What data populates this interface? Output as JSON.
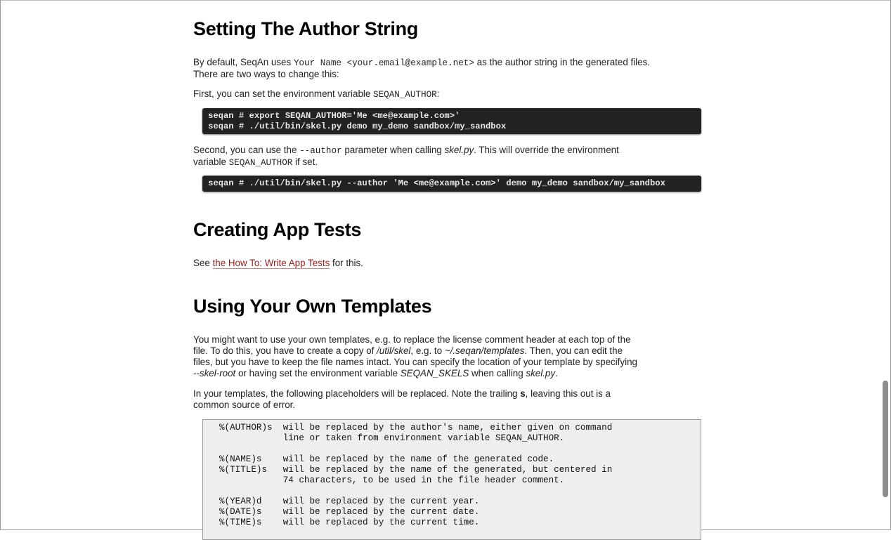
{
  "sections": {
    "author": {
      "heading": "Setting The Author String",
      "p1": {
        "a": "By default, SeqAn uses ",
        "code": "Your Name <your.email@example.net>",
        "b": " as the author string in the generated files.",
        "line2": "There are two ways to change this:"
      },
      "p2": {
        "a": "First, you can set the environment variable ",
        "code": "SEQAN_AUTHOR",
        "b": ":"
      },
      "shell1": {
        "line1": "seqan # export SEQAN_AUTHOR='Me <me@example.com>'",
        "line2": "seqan # ./util/bin/skel.py demo my_demo sandbox/my_sandbox"
      },
      "p3": {
        "a": "Second, you can use the ",
        "code": "--author",
        "b": " parameter when calling ",
        "em": "skel.py",
        "c": ". This will override the environment",
        "line2a": "variable ",
        "code2": "SEQAN_AUTHOR",
        "line2b": " if set."
      },
      "shell2": {
        "line1": "seqan # ./util/bin/skel.py --author 'Me <me@example.com>' demo my_demo sandbox/my_sandbox"
      }
    },
    "tests": {
      "heading": "Creating App Tests",
      "a": "See ",
      "link": "the How To: Write App Tests",
      "b": " for this."
    },
    "templates": {
      "heading": "Using Your Own Templates",
      "l1": "You might want to use your own templates, e.g. to replace the license comment header at each top of the",
      "l2a": "file. To do this, you have to create a copy of ",
      "l2em1": "/util/skel",
      "l2b": ", e.g. to ",
      "l2em2": "~/.seqan/templates",
      "l2c": ". Then, you can edit the",
      "l3": "files, but you have to keep the file names intact. You can specify the location of your template by specifying",
      "l4em1": "--skel-root",
      "l4a": " or having set the environment variable ",
      "l4em2": "SEQAN_SKELS",
      "l4b": " when calling ",
      "l4em3": "skel.py",
      "l4c": ".",
      "p2a": "In your templates, the following placeholders will be replaced. Note the trailing ",
      "p2b": "s",
      "p2c": ", leaving this out is a",
      "p2line2": "common source of error.",
      "literal": [
        "%(AUTHOR)s  will be replaced by the author's name, either given on command",
        "            line or taken from environment variable SEQAN_AUTHOR.",
        "",
        "%(NAME)s    will be replaced by the name of the generated code.",
        "%(TITLE)s   will be replaced by the name of the generated, but centered in",
        "            74 characters, to be used in the file header comment.",
        "",
        "%(YEAR)d    will be replaced by the current year.",
        "%(DATE)s    will be replaced by the current date.",
        "%(TIME)s    will be replaced by the current time."
      ]
    }
  }
}
